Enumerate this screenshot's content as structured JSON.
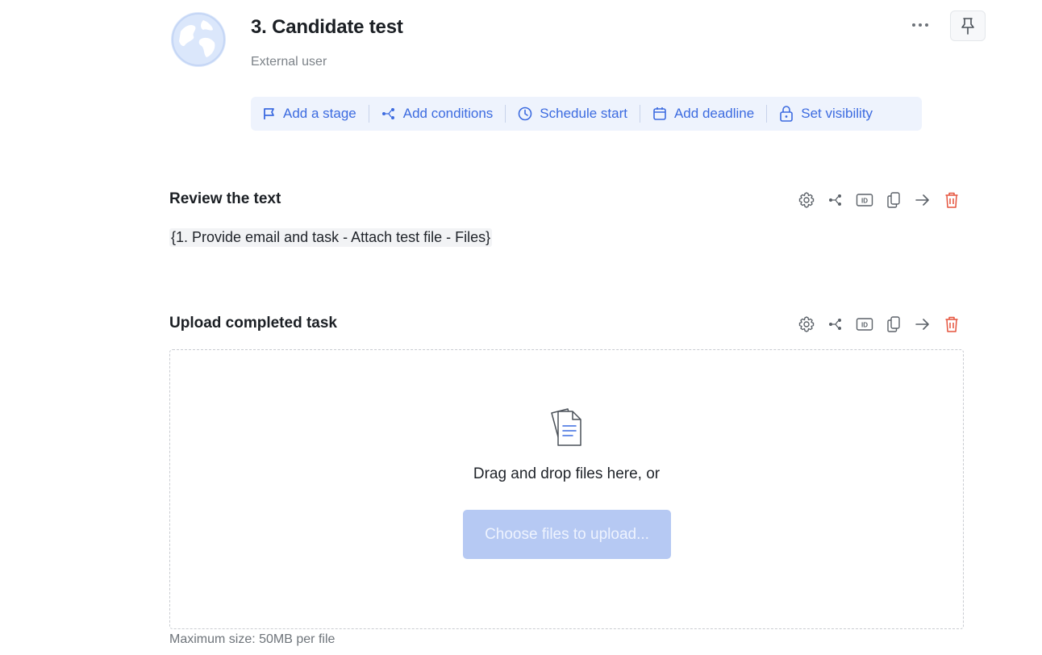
{
  "stage": {
    "title": "3. Candidate test",
    "subtitle": "External user",
    "avatar_icon": "globe-icon"
  },
  "header_icons": {
    "more": "more-icon",
    "pin": "pin-icon"
  },
  "actions": [
    {
      "label": "Add a stage",
      "icon": "flag-icon"
    },
    {
      "label": "Add conditions",
      "icon": "branch-icon"
    },
    {
      "label": "Schedule start",
      "icon": "clock-icon"
    },
    {
      "label": "Add deadline",
      "icon": "calendar-icon"
    },
    {
      "label": "Set visibility",
      "icon": "lock-icon"
    }
  ],
  "sections": [
    {
      "title": "Review the text",
      "content": "{1. Provide email and task - Attach test file - Files}",
      "tools": [
        "settings-icon",
        "branch-icon",
        "id-icon",
        "copy-icon",
        "move-icon",
        "delete-icon"
      ]
    },
    {
      "title": "Upload completed task",
      "tools": [
        "settings-icon",
        "branch-icon",
        "id-icon",
        "copy-icon",
        "move-icon",
        "delete-icon"
      ]
    }
  ],
  "upload": {
    "drop_text": "Drag and drop files here, or",
    "button_label": "Choose files to upload...",
    "max_size": "Maximum size: 50MB per file",
    "icon": "documents-icon"
  },
  "colors": {
    "accent": "#3c6be0",
    "action_bar_bg": "#eef3fd",
    "danger": "#e5533d",
    "button_disabled_bg": "#b6c9f3"
  }
}
